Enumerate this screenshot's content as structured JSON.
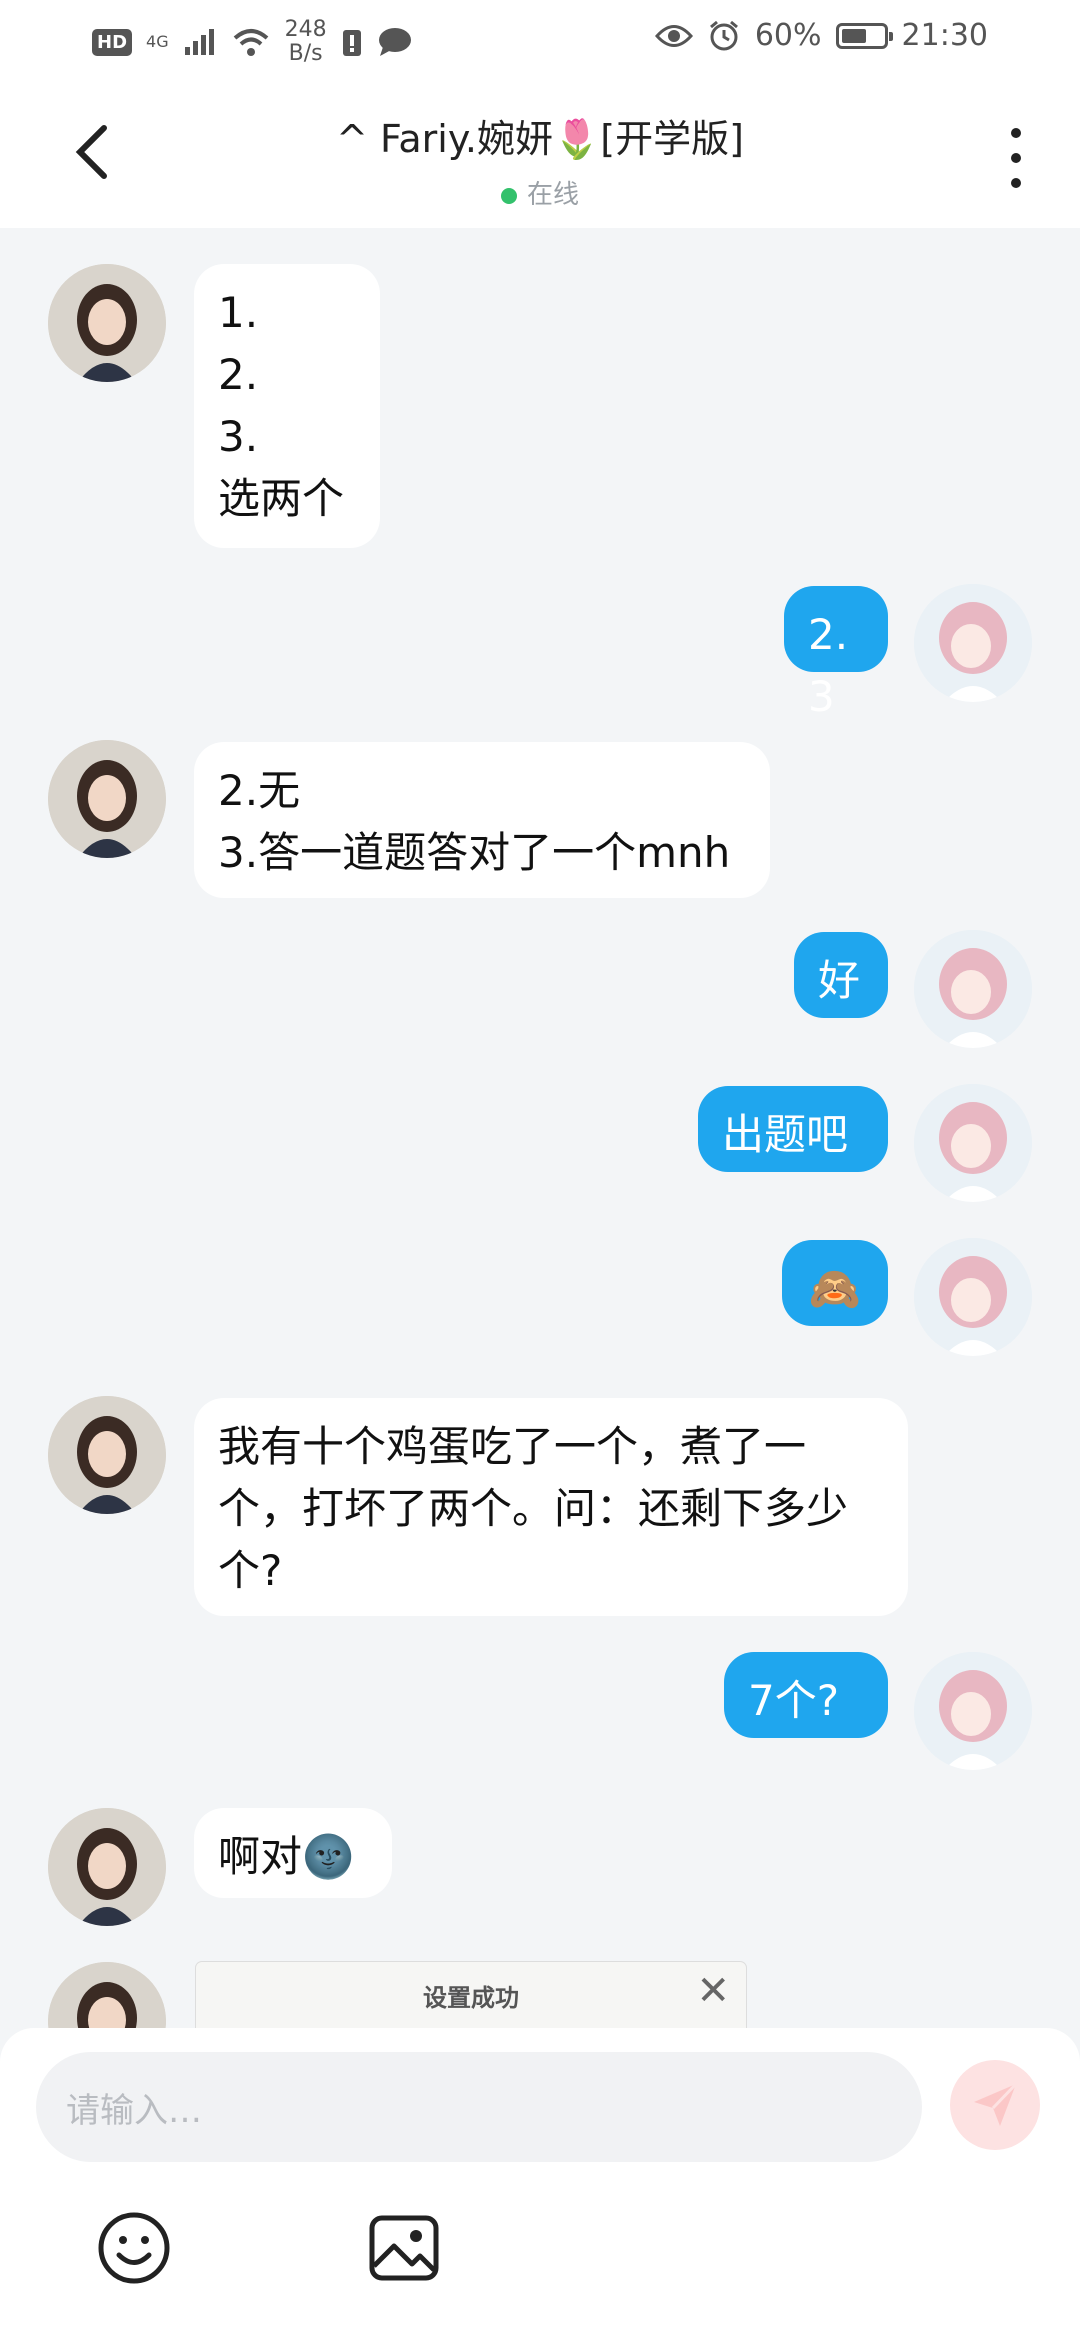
{
  "statusbar": {
    "hd": "HD",
    "net": "4G",
    "speed_value": "248",
    "speed_unit": "B/s",
    "battery": "60%",
    "battery_level": 0.6,
    "time": "21:30"
  },
  "header": {
    "title": "^ Fariy.婉妍🌷[开学版]",
    "status": "在线"
  },
  "messages": [
    {
      "side": "in",
      "text": "1.\n2.\n3.\n选两个"
    },
    {
      "side": "out",
      "text": "2.3"
    },
    {
      "side": "in",
      "text": "2.无\n3.答一道题答对了一个mnh"
    },
    {
      "side": "out",
      "text": "好"
    },
    {
      "side": "out",
      "text": "出题吧"
    },
    {
      "side": "out",
      "text": "🙈"
    },
    {
      "side": "in",
      "text": "我有十个鸡蛋吃了一个，煮了一个，打坏了两个。问：还剩下多少个?"
    },
    {
      "side": "out",
      "text": "7个?"
    },
    {
      "side": "in",
      "text": "啊对🌚"
    }
  ],
  "toast": {
    "text": "设置成功",
    "close": "✕"
  },
  "composer": {
    "placeholder": "请输入…",
    "send_icon": "send-icon",
    "emoji_icon": "smile-icon",
    "image_icon": "image-icon"
  },
  "colors": {
    "accent": "#1fa6ee",
    "online": "#33c16c",
    "send_bg": "#fde2e2"
  }
}
